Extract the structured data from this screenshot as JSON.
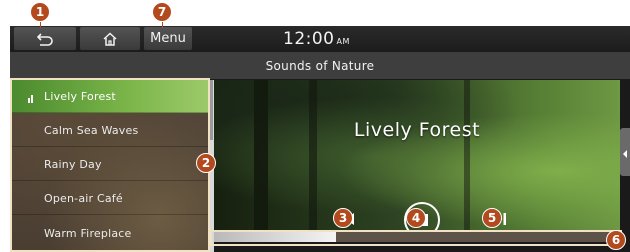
{
  "header": {
    "back_icon": "back-arrow-icon",
    "home_icon": "home-icon",
    "menu_label": "Menu",
    "clock_time": "12:00",
    "clock_ampm": "AM"
  },
  "title_bar": {
    "title": "Sounds of Nature"
  },
  "playlist": {
    "items": [
      {
        "label": "Lively Forest",
        "active": true
      },
      {
        "label": "Calm Sea Waves"
      },
      {
        "label": "Rainy Day"
      },
      {
        "label": "Open-air Café"
      },
      {
        "label": "Warm Fireplace"
      }
    ]
  },
  "player": {
    "now_playing": "Lively Forest",
    "controls": [
      "previous-track-icon",
      "stop-icon",
      "next-track-icon"
    ],
    "progress_fraction": 0.3
  },
  "callouts": [
    "1",
    "2",
    "3",
    "4",
    "5",
    "6",
    "7"
  ],
  "colors": {
    "active_item": "#7cb64a",
    "callout": "#b34a1e",
    "screen_bg": "#1a1a1a"
  }
}
